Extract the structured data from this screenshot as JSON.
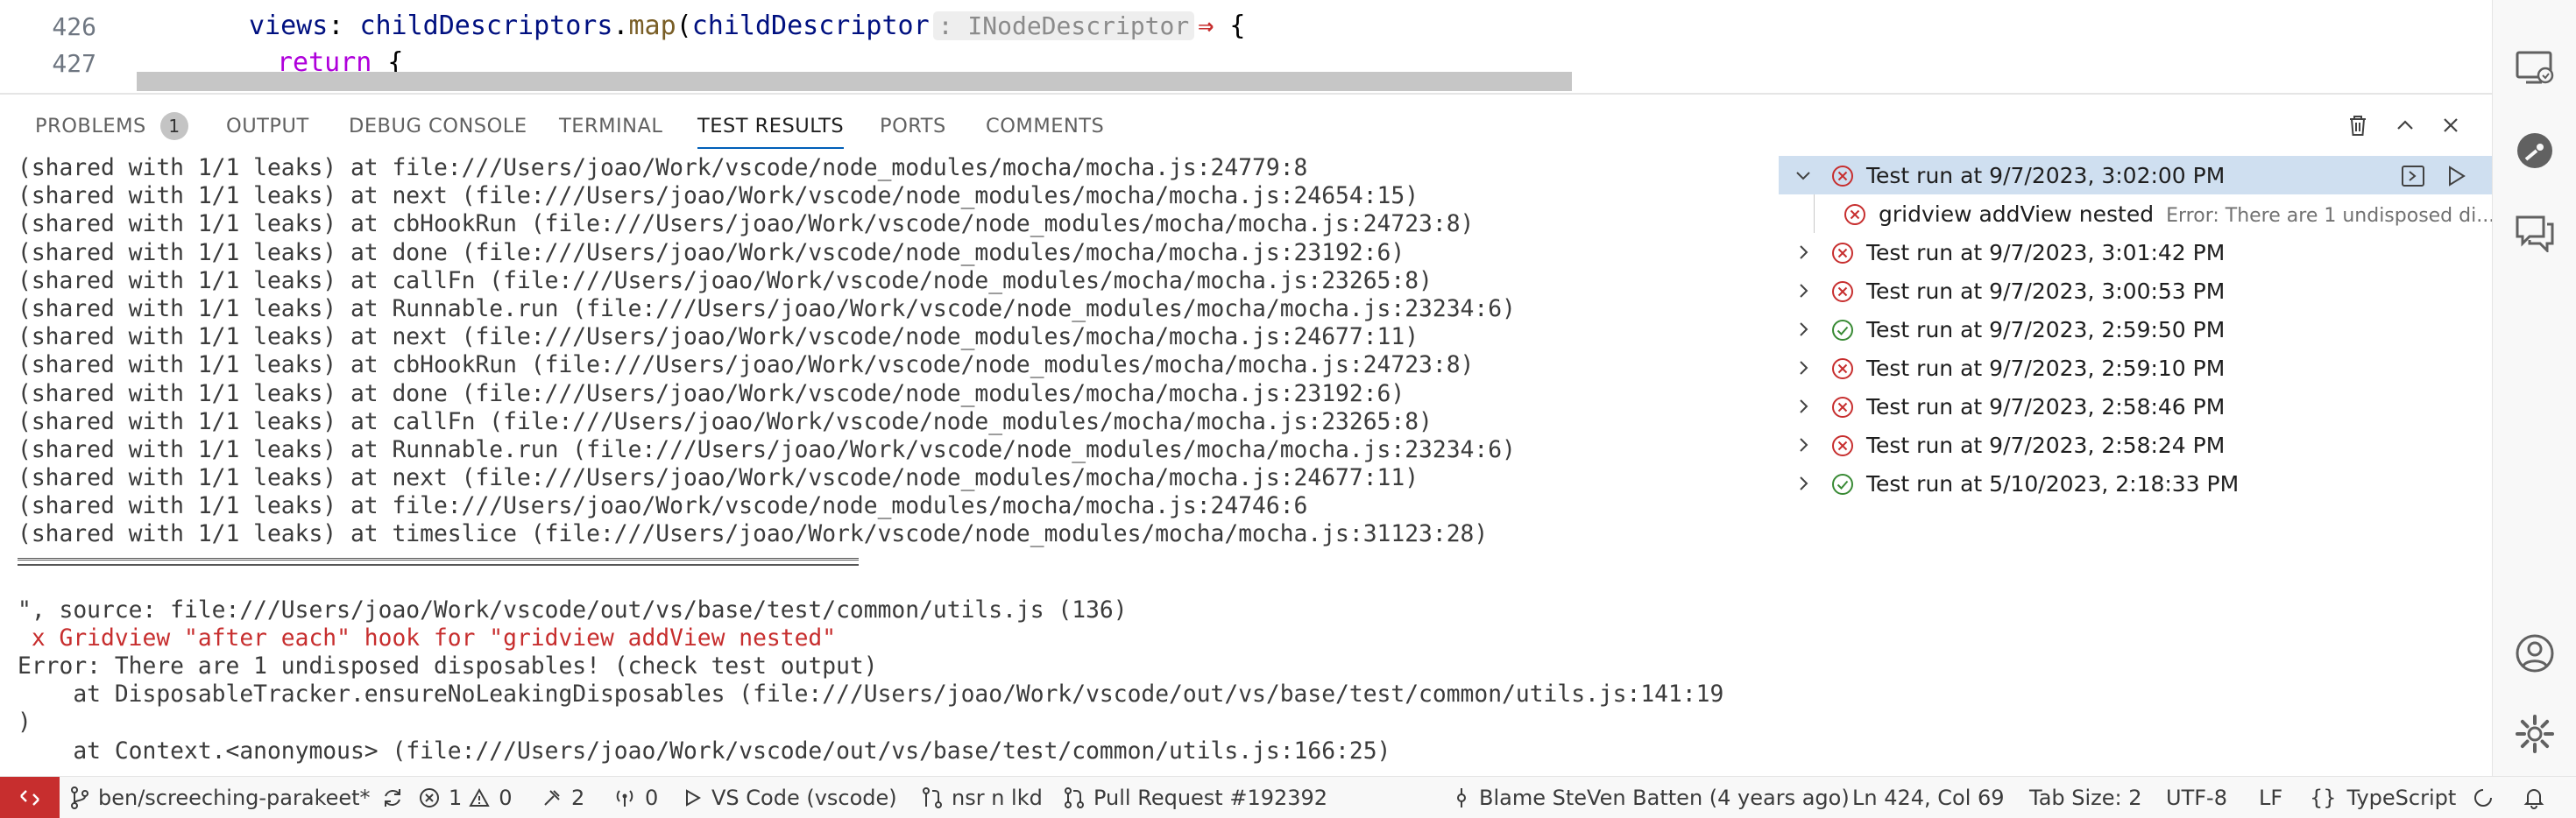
{
  "editor": {
    "lines": [
      {
        "num": "426",
        "text": {
          "prop": "views",
          "colon": ": ",
          "obj": "childDescriptors",
          "dot": ".",
          "fn": "map",
          "paren": "(",
          "param": "childDescriptor",
          "inlay": ": INodeDescriptor",
          "arrow": "⇒",
          "brace": " {"
        }
      },
      {
        "num": "427",
        "kw": "return",
        "brace": " {"
      }
    ]
  },
  "panel": {
    "tabs": [
      {
        "label": "PROBLEMS",
        "badge": "1"
      },
      {
        "label": "OUTPUT"
      },
      {
        "label": "DEBUG CONSOLE"
      },
      {
        "label": "TERMINAL"
      },
      {
        "label": "TEST RESULTS",
        "active": true
      },
      {
        "label": "PORTS"
      },
      {
        "label": "COMMENTS"
      }
    ],
    "actions": [
      "trash-icon",
      "chevron-up-icon",
      "close-icon"
    ]
  },
  "output": {
    "lines": [
      "(shared with 1/1 leaks) at file:///Users/joao/Work/vscode/node_modules/mocha/mocha.js:24779:8",
      "(shared with 1/1 leaks) at next (file:///Users/joao/Work/vscode/node_modules/mocha/mocha.js:24654:15)",
      "(shared with 1/1 leaks) at cbHookRun (file:///Users/joao/Work/vscode/node_modules/mocha/mocha.js:24723:8)",
      "(shared with 1/1 leaks) at done (file:///Users/joao/Work/vscode/node_modules/mocha/mocha.js:23192:6)",
      "(shared with 1/1 leaks) at callFn (file:///Users/joao/Work/vscode/node_modules/mocha/mocha.js:23265:8)",
      "(shared with 1/1 leaks) at Runnable.run (file:///Users/joao/Work/vscode/node_modules/mocha/mocha.js:23234:6)",
      "(shared with 1/1 leaks) at next (file:///Users/joao/Work/vscode/node_modules/mocha/mocha.js:24677:11)",
      "(shared with 1/1 leaks) at cbHookRun (file:///Users/joao/Work/vscode/node_modules/mocha/mocha.js:24723:8)",
      "(shared with 1/1 leaks) at done (file:///Users/joao/Work/vscode/node_modules/mocha/mocha.js:23192:6)",
      "(shared with 1/1 leaks) at callFn (file:///Users/joao/Work/vscode/node_modules/mocha/mocha.js:23265:8)",
      "(shared with 1/1 leaks) at Runnable.run (file:///Users/joao/Work/vscode/node_modules/mocha/mocha.js:23234:6)",
      "(shared with 1/1 leaks) at next (file:///Users/joao/Work/vscode/node_modules/mocha/mocha.js:24677:11)",
      "(shared with 1/1 leaks) at file:///Users/joao/Work/vscode/node_modules/mocha/mocha.js:24746:6",
      "(shared with 1/1 leaks) at timeslice (file:///Users/joao/Work/vscode/node_modules/mocha/mocha.js:31123:28)"
    ],
    "after": [
      {
        "text": "\", source: file:///Users/joao/Work/vscode/out/vs/base/test/common/utils.js (136)",
        "red": false
      },
      {
        "text": " x Gridview \"after each\" hook for \"gridview addView nested\"",
        "red": true
      },
      {
        "text": "Error: There are 1 undisposed disposables! (check test output)",
        "red": false
      },
      {
        "text": "    at DisposableTracker.ensureNoLeakingDisposables (file:///Users/joao/Work/vscode/out/vs/base/test/common/utils.js:141:19",
        "red": false
      },
      {
        "text": ")",
        "red": false
      },
      {
        "text": "    at Context.<anonymous> (file:///Users/joao/Work/vscode/out/vs/base/test/common/utils.js:166:25)",
        "red": false
      }
    ]
  },
  "tests": {
    "runs": [
      {
        "label": "Test run at 9/7/2023, 3:02:00 PM",
        "status": "failed",
        "expanded": true,
        "selected": true
      },
      {
        "label": "gridview addView nested",
        "status": "failed",
        "child": true,
        "desc": "Error: There are 1 undisposed di..."
      },
      {
        "label": "Test run at 9/7/2023, 3:01:42 PM",
        "status": "failed"
      },
      {
        "label": "Test run at 9/7/2023, 3:00:53 PM",
        "status": "failed"
      },
      {
        "label": "Test run at 9/7/2023, 2:59:50 PM",
        "status": "passed"
      },
      {
        "label": "Test run at 9/7/2023, 2:59:10 PM",
        "status": "failed"
      },
      {
        "label": "Test run at 9/7/2023, 2:58:46 PM",
        "status": "failed"
      },
      {
        "label": "Test run at 9/7/2023, 2:58:24 PM",
        "status": "failed"
      },
      {
        "label": "Test run at 5/10/2023, 2:18:33 PM",
        "status": "passed"
      }
    ],
    "row_actions": [
      "go-to-file-icon",
      "run-icon"
    ]
  },
  "activity_bar": [
    "remote-explorer-icon",
    "gitlens-icon",
    "comments-icon",
    "account-icon",
    "settings-gear-icon"
  ],
  "status": {
    "branch": "ben/screeching-parakeet*",
    "errors": "1",
    "warnings": "0",
    "tools": "2",
    "ports": "0",
    "debug": "VS Code (vscode)",
    "git": "nsr n lkd",
    "pr": "Pull Request #192392",
    "blame": "Blame SteVen Batten (4 years ago)",
    "position": "Ln 424, Col 69",
    "tabsize": "Tab Size: 2",
    "encoding": "UTF-8",
    "eol": "LF",
    "language": "TypeScript"
  },
  "colors": {
    "accent": "#005fb8",
    "error": "#c72e2e",
    "pass": "#388a34",
    "remote_bg": "#c72e2e"
  }
}
